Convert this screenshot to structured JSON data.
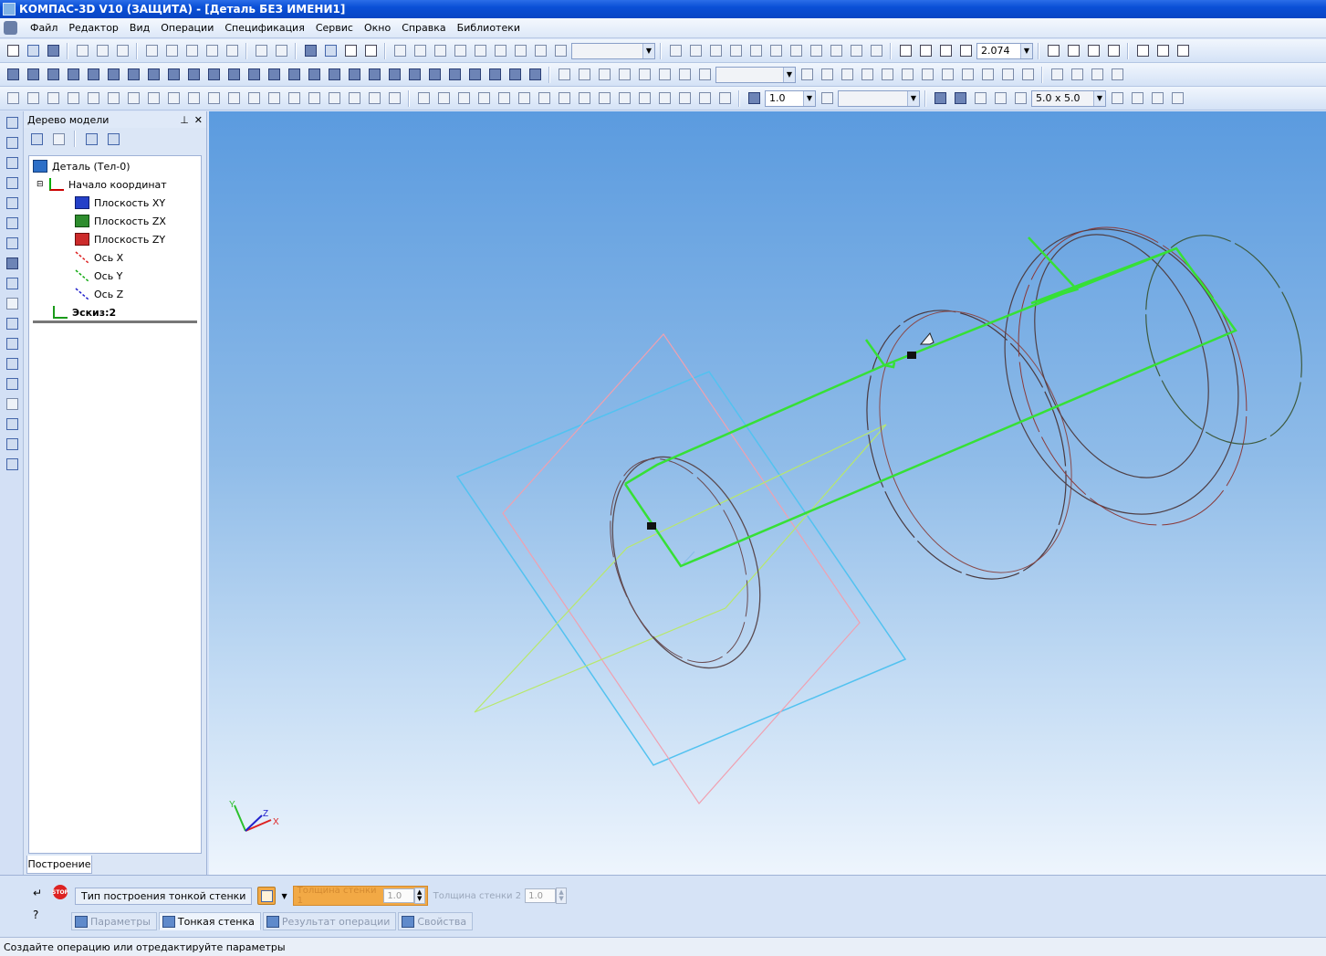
{
  "window": {
    "title": "КОМПАС-3D V10 (ЗАЩИТА) - [Деталь БЕЗ ИМЕНИ1]"
  },
  "menu": [
    "Файл",
    "Редактор",
    "Вид",
    "Операции",
    "Спецификация",
    "Сервис",
    "Окно",
    "Справка",
    "Библиотеки"
  ],
  "toolbar": {
    "zoom_value": "2.074",
    "style_value": "",
    "step_value": "1.0",
    "grid_value": "5.0 x 5.0"
  },
  "tree": {
    "title": "Дерево модели",
    "items": [
      "Деталь (Тел-0)",
      "Начало координат",
      "Плоскость XY",
      "Плоскость ZX",
      "Плоскость ZY",
      "Ось X",
      "Ось Y",
      "Ось Z",
      "Эскиз:2"
    ],
    "tab": "Построение"
  },
  "viewport": {
    "axis_labels": [
      "Y",
      "Z",
      "X"
    ]
  },
  "properties": {
    "thin_wall_type_label": "Тип построения тонкой стенки",
    "wall_thickness_1_label": "Толщина стенки 1",
    "wall_thickness_1_value": "1.0",
    "wall_thickness_2_label": "Толщина стенки 2",
    "wall_thickness_2_value": "1.0",
    "tabs": [
      "Параметры",
      "Тонкая стенка",
      "Результат операции",
      "Свойства"
    ]
  },
  "status": {
    "message": "Создайте операцию или отредактируйте параметры"
  },
  "colors": {
    "titlebar": "#0a4fd6",
    "sketch_green": "#33e133",
    "viewport_top": "#5b9bdf",
    "highlight_orange": "#f2a945"
  }
}
